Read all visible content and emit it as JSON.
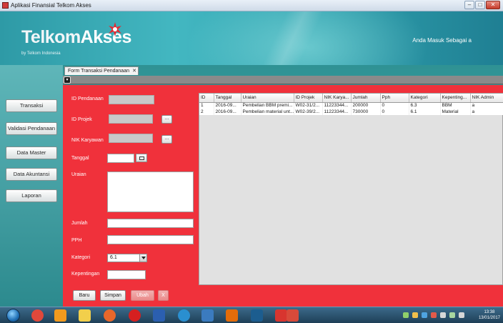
{
  "window": {
    "title": "Aplikasi Finansial Telkom Akses",
    "controls": [
      "–",
      "□",
      "✕"
    ]
  },
  "header": {
    "brand_part1": "Telkom",
    "brand_part2": "Akses",
    "subtitle": "by Telkom Indonesia",
    "login_label": "Anda Masuk Sebagai a"
  },
  "nav": {
    "items": [
      {
        "label": "Transaksi"
      },
      {
        "label": "Validasi Pendanaan"
      },
      {
        "label": "Data Master"
      },
      {
        "label": "Data Akuntansi"
      },
      {
        "label": "Laporan"
      }
    ]
  },
  "tab": {
    "label": "Form Transaksi Pendanaan",
    "close": "✕"
  },
  "frame": {
    "collapse_icon": "▾"
  },
  "form": {
    "id_pendanaan_label": "ID Pendanaan",
    "id_pendanaan_value": "",
    "id_projek_label": "ID Projek",
    "id_projek_value": "",
    "nik_karyawan_label": "NIK Karyawan",
    "nik_karyawan_value": "",
    "tanggal_label": "Tanggal",
    "tanggal_value": "",
    "uraian_label": "Uraian",
    "uraian_value": "",
    "jumlah_label": "Jumlah",
    "jumlah_value": "",
    "pph_label": "PPH",
    "pph_value": "",
    "kategori_label": "Kategori",
    "kategori_value": "6.1",
    "kepentingan_label": "Kepentingan",
    "kepentingan_value": "",
    "browse_label": "...",
    "buttons": {
      "baru": "Baru",
      "simpan": "Simpan",
      "ubah": "Ubah",
      "x": "X"
    }
  },
  "table": {
    "columns": [
      "ID",
      "Tanggal",
      "Uraian",
      "ID Projek",
      "NIK Karya...",
      "Jumlah",
      "Pph",
      "Kategori",
      "Kepenting...",
      "NIK Admin"
    ],
    "rows": [
      [
        "1",
        "2016-09...",
        "Pembelian BBM premi...",
        "W02-31/2...",
        "11223344...",
        "200000",
        "0",
        "6.3",
        "BBM",
        "a"
      ],
      [
        "2",
        "2016-09...",
        "Pembelian material unt...",
        "W02-39/2...",
        "11223344...",
        "730000",
        "0",
        "6.1",
        "Material",
        "a"
      ]
    ]
  },
  "taskbar": {
    "time": "13:38",
    "date": "13/01/2017",
    "icons": [
      "start-orb",
      "chrome-icon",
      "media-player-icon",
      "explorer-icon",
      "firefox-icon",
      "opera-icon",
      "word-icon",
      "ie-icon",
      "netbeans-icon",
      "xampp-icon",
      "photoshop-icon",
      "excel-icon",
      "app-icon"
    ],
    "colors": {
      "chrome": "#e0483b",
      "media": "#f29a1e",
      "explorer": "#f2cf4b",
      "firefox": "#e8672a",
      "opera": "#d62020",
      "word": "#2b5fb0",
      "ie": "#2a8fd0",
      "netbeans": "#3b7bbf",
      "xampp": "#e36c0a",
      "photoshop": "#1c5d8f",
      "excel": "#d8352f",
      "app": "#d84a3a"
    }
  }
}
